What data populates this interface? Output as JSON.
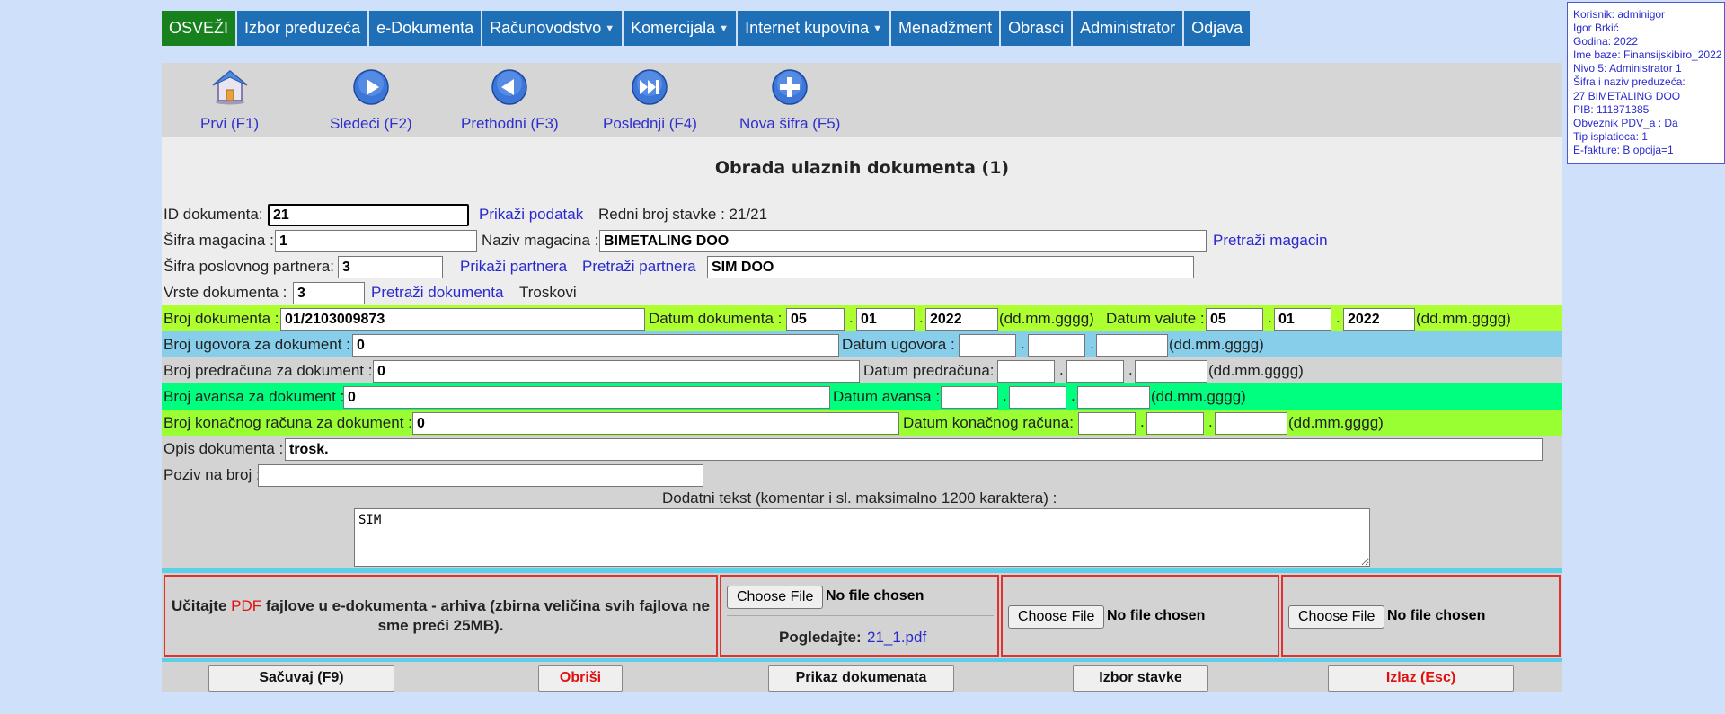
{
  "nav": [
    {
      "label": "OSVEŽI",
      "caret": false
    },
    {
      "label": "Izbor preduzeća",
      "caret": false
    },
    {
      "label": "e-Dokumenta",
      "caret": false
    },
    {
      "label": "Računovodstvo",
      "caret": true
    },
    {
      "label": "Komercijala",
      "caret": true
    },
    {
      "label": "Internet kupovina",
      "caret": true
    },
    {
      "label": "Menadžment",
      "caret": false
    },
    {
      "label": "Obrasci",
      "caret": false
    },
    {
      "label": "Administrator",
      "caret": false
    },
    {
      "label": "Odjava",
      "caret": false
    }
  ],
  "info": [
    "Korisnik: adminigor",
    "Igor Brkić",
    "Godina: 2022",
    "Ime baze: Finansijskibiro_2022",
    "Nivo 5: Administrator 1",
    "Šifra i naziv preduzeća:",
    "27 BIMETALING DOO",
    "PIB: 111871385",
    "Obveznik PDV_a : Da",
    "Tip isplatioca: 1",
    "E-fakture: B opcija=1"
  ],
  "toolbar": {
    "first": "Prvi (F1)",
    "next": "Sledeći (F2)",
    "prev": "Prethodni (F3)",
    "last": "Poslednji (F4)",
    "new": "Nova šifra (F5)"
  },
  "form": {
    "title": "Obrada ulaznih dokumenta (1)",
    "id_label": "ID dokumenta:",
    "id_value": "21",
    "show_data_link": "Prikaži podatak",
    "row_number": "Redni broj stavke : 21/21",
    "warehouse_code_label": "Šifra magacina :",
    "warehouse_code": "1",
    "warehouse_name_label": "Naziv magacina :",
    "warehouse_name": "BIMETALING DOO",
    "search_warehouse": "Pretraži magacin",
    "partner_code_label": "Šifra poslovnog partnera:",
    "partner_code": "3",
    "show_partner": "Prikaži partnera",
    "search_partner": "Pretraži partnera",
    "partner_name": "SIM DOO",
    "doc_type_label": "Vrste dokumenta :",
    "doc_type": "3",
    "search_doc": "Pretraži dokumenta",
    "doc_type_name": "Troskovi",
    "doc_number_label": "Broj dokumenta :",
    "doc_number": "01/2103009873",
    "doc_date_label": "Datum dokumenta :",
    "doc_date_d": "05",
    "doc_date_m": "01",
    "doc_date_y": "2022",
    "date_format": "(dd.mm.gggg)",
    "value_date_label": "Datum valute :",
    "value_date_d": "05",
    "value_date_m": "01",
    "value_date_y": "2022",
    "contract_label": "Broj ugovora za dokument :",
    "contract_value": "0",
    "contract_date_label": "Datum ugovora :",
    "proforma_label": "Broj predračuna za dokument :",
    "proforma_value": "0",
    "proforma_date_label": "Datum predračuna:",
    "advance_label": "Broj avansa za dokument :",
    "advance_value": "0",
    "advance_date_label": "Datum avansa :",
    "final_label": "Broj konačnog računa za dokument :",
    "final_value": "0",
    "final_date_label": "Datum konačnog računa:",
    "desc_label": "Opis dokumenta :",
    "desc_value": "trosk.",
    "ref_label": "Poziv na broj :",
    "ref_value": "",
    "extra_label": "Dodatni tekst (komentar i sl. maksimalno 1200 karaktera) :",
    "extra_value": "SIM",
    "dot": "."
  },
  "upload": {
    "text_before": "Učitajte ",
    "text_pdf": "PDF",
    "text_after": " fajlove u e-dokumenta - arhiva (zbirna veličina svih fajlova ne sme preći 25MB).",
    "choose": "Choose File",
    "no_file": "No file chosen",
    "view_label": "Pogledajte:",
    "file_link": "21_1.pdf"
  },
  "actions": {
    "save": "Sačuvaj (F9)",
    "delete": "Obriši",
    "show_docs": "Prikaz dokumenata",
    "choose_item": "Izbor stavke",
    "exit": "Izlaz (Esc)"
  },
  "colors": {
    "nav_blue": "#1f6fb6",
    "nav_green": "#17811e",
    "link_blue": "#2a2acc",
    "row_lime": "#adff2f",
    "row_sky": "#87ceeb",
    "row_green": "#00ff7f",
    "row_chartreuse": "#99ff33",
    "danger_red": "#e01010"
  }
}
